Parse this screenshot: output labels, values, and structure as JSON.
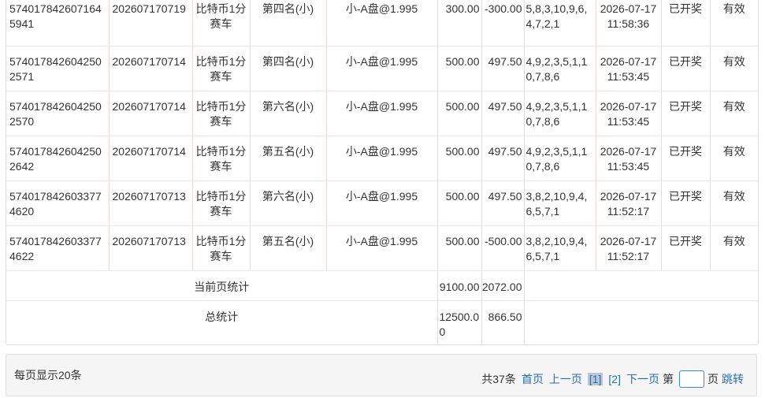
{
  "rows": [
    {
      "order": "5740178426071645941",
      "issue": "202607170719",
      "game": "比特币1分赛车",
      "play": "第四名(小)",
      "odds": "小-A盘@1.995",
      "amount": "300.00",
      "result": "-300.00",
      "numbers": "5,8,3,10,9,6,4,7,2,1",
      "time": "2026-07-17 11:58:36",
      "status": "已开奖",
      "valid": "有效"
    },
    {
      "order": "5740178426042502571",
      "issue": "202607170714",
      "game": "比特币1分赛车",
      "play": "第四名(小)",
      "odds": "小-A盘@1.995",
      "amount": "500.00",
      "result": "497.50",
      "numbers": "4,9,2,3,5,1,10,7,8,6",
      "time": "2026-07-17 11:53:45",
      "status": "已开奖",
      "valid": "有效"
    },
    {
      "order": "5740178426042502570",
      "issue": "202607170714",
      "game": "比特币1分赛车",
      "play": "第六名(小)",
      "odds": "小-A盘@1.995",
      "amount": "500.00",
      "result": "497.50",
      "numbers": "4,9,2,3,5,1,10,7,8,6",
      "time": "2026-07-17 11:53:45",
      "status": "已开奖",
      "valid": "有效"
    },
    {
      "order": "5740178426042502642",
      "issue": "202607170714",
      "game": "比特币1分赛车",
      "play": "第五名(小)",
      "odds": "小-A盘@1.995",
      "amount": "500.00",
      "result": "497.50",
      "numbers": "4,9,2,3,5,1,10,7,8,6",
      "time": "2026-07-17 11:53:45",
      "status": "已开奖",
      "valid": "有效"
    },
    {
      "order": "5740178426033774620",
      "issue": "202607170713",
      "game": "比特币1分赛车",
      "play": "第六名(小)",
      "odds": "小-A盘@1.995",
      "amount": "500.00",
      "result": "497.50",
      "numbers": "3,8,2,10,9,4,6,5,7,1",
      "time": "2026-07-17 11:52:17",
      "status": "已开奖",
      "valid": "有效"
    },
    {
      "order": "5740178426033774622",
      "issue": "202607170713",
      "game": "比特币1分赛车",
      "play": "第五名(小)",
      "odds": "小-A盘@1.995",
      "amount": "500.00",
      "result": "-500.00",
      "numbers": "3,8,2,10,9,4,6,5,7,1",
      "time": "2026-07-17 11:52:17",
      "status": "已开奖",
      "valid": "有效"
    }
  ],
  "summary": {
    "page_label": "当前页统计",
    "page_amount": "9100.00",
    "page_result": "2072.00",
    "total_label": "总统计",
    "total_amount": "12500.00",
    "total_result": "866.50"
  },
  "pager": {
    "page_size_text": "每页显示20条",
    "total_count": "共37条",
    "first": "首页",
    "prev": "上一页",
    "page1": "[1]",
    "page2": "[2]",
    "next": "下一页",
    "goto_prefix": "第",
    "goto_value": "",
    "goto_suffix": "页",
    "jump": "跳转"
  }
}
